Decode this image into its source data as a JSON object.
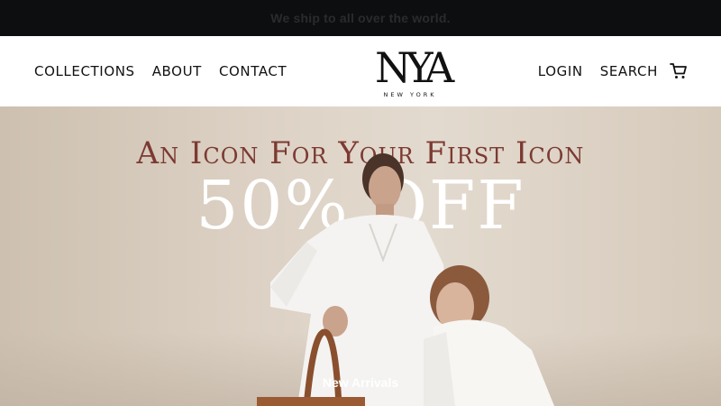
{
  "announcement": {
    "text": "We ship to all over the world."
  },
  "header": {
    "nav_left": [
      {
        "label": "COLLECTIONS"
      },
      {
        "label": "ABOUT"
      },
      {
        "label": "CONTACT"
      }
    ],
    "logo": {
      "monogram": "NYA",
      "subtitle": "NEW YORK"
    },
    "nav_right": [
      {
        "label": "LOGIN"
      },
      {
        "label": "SEARCH"
      }
    ],
    "cart_icon": "cart-icon"
  },
  "hero": {
    "headline": "An Icon For Your First Icon",
    "offer": "50% OFF",
    "link_label": "New Arrivals"
  },
  "colors": {
    "announcement_bg": "#0d0e10",
    "headline": "#7c3a32",
    "hero_bg": "#dcd1c4"
  }
}
